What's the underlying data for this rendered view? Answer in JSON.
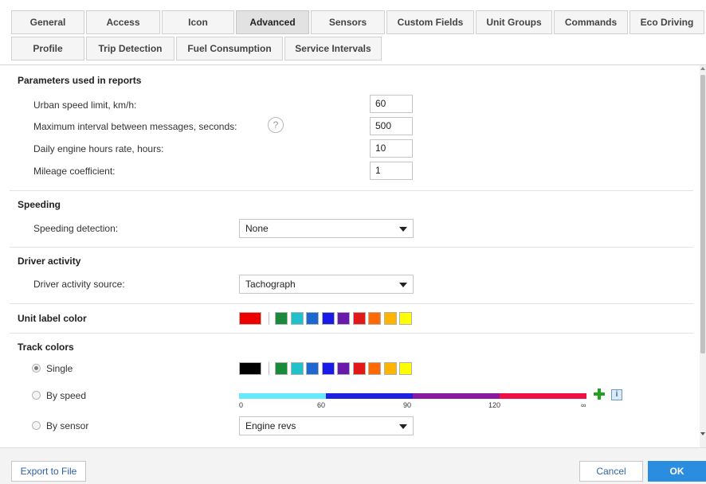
{
  "tabs": [
    {
      "label": "General"
    },
    {
      "label": "Access"
    },
    {
      "label": "Icon"
    },
    {
      "label": "Advanced",
      "active": true
    },
    {
      "label": "Sensors"
    },
    {
      "label": "Custom Fields"
    },
    {
      "label": "Unit Groups"
    },
    {
      "label": "Commands"
    },
    {
      "label": "Eco Driving"
    },
    {
      "label": "Profile"
    },
    {
      "label": "Trip Detection"
    },
    {
      "label": "Fuel Consumption"
    },
    {
      "label": "Service Intervals"
    }
  ],
  "parameters": {
    "title": "Parameters used in reports",
    "urban_speed_label": "Urban speed limit, km/h:",
    "urban_speed_value": "60",
    "max_interval_label": "Maximum interval between messages, seconds:",
    "max_interval_value": "500",
    "engine_hours_label": "Daily engine hours rate, hours:",
    "engine_hours_value": "10",
    "mileage_label": "Mileage coefficient:",
    "mileage_value": "1",
    "help_glyph": "?"
  },
  "speeding": {
    "title": "Speeding",
    "detection_label": "Speeding detection:",
    "detection_value": "None"
  },
  "driver_activity": {
    "title": "Driver activity",
    "source_label": "Driver activity source:",
    "source_value": "Tachograph"
  },
  "unit_label_color": {
    "title": "Unit label color",
    "current": "#ee0000"
  },
  "track_colors": {
    "title": "Track colors",
    "single_label": "Single",
    "single_current": "#000000",
    "by_speed_label": "By speed",
    "by_sensor_label": "By sensor",
    "sensor_value": "Engine revs",
    "selected": "single",
    "speed_ticks": [
      "0",
      "60",
      "90",
      "120",
      "∞"
    ],
    "speed_segments": [
      {
        "color": "#66e8ff",
        "share": 0.25
      },
      {
        "color": "#2020e0",
        "share": 0.25
      },
      {
        "color": "#8a1aa0",
        "share": 0.25
      },
      {
        "color": "#ee1144",
        "share": 0.25
      }
    ],
    "info_glyph": "i"
  },
  "palette": [
    "#1a8a3a",
    "#22c0c8",
    "#1e66d0",
    "#1a1ae6",
    "#6a1aa8",
    "#e01818",
    "#ff6a00",
    "#ffb400",
    "#ffff00"
  ],
  "footer": {
    "export_label": "Export to File",
    "cancel_label": "Cancel",
    "ok_label": "OK"
  },
  "colors": {
    "accent": "#2a8de0",
    "link": "#3264a8",
    "plus": "#22a022"
  }
}
